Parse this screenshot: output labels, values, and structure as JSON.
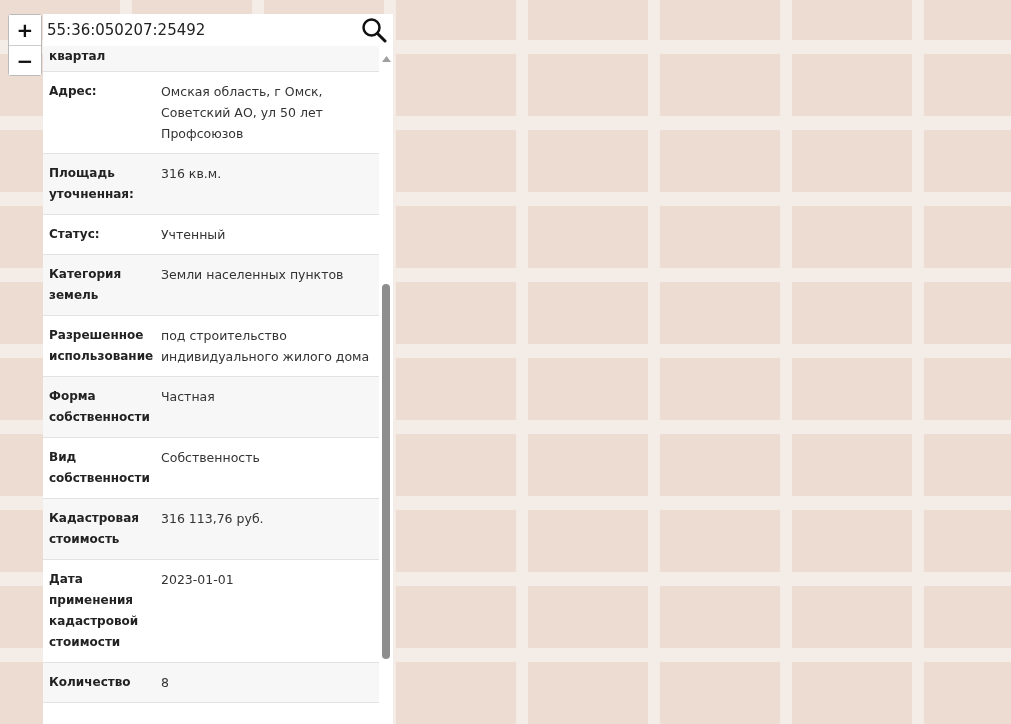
{
  "search": {
    "value": "55:36:050207:25492"
  },
  "zoom": {
    "plus": "+",
    "minus": "−"
  },
  "rows": [
    {
      "label": "квартал"
    },
    {
      "label": "Адрес:",
      "value": "Омская область, г Омск, Советский АО, ул 50 лет Профсоюзов"
    },
    {
      "label": "Площадь уточненная:",
      "value": "316 кв.м."
    },
    {
      "label": "Статус:",
      "value": "Учтенный"
    },
    {
      "label": "Категория земель",
      "value": "Земли населенных пунктов"
    },
    {
      "label": "Разрешенное использование",
      "value": "под строительство индивидуального жилого дома"
    },
    {
      "label": "Форма собственности",
      "value": "Частная"
    },
    {
      "label": "Вид собственности",
      "value": "Собственность"
    },
    {
      "label": "Кадастровая стоимость",
      "value": "316 113,76 руб."
    },
    {
      "label": "Дата применения кадастровой стоимости",
      "value": "2023-01-01"
    },
    {
      "label": "Количество",
      "value": "8"
    }
  ]
}
